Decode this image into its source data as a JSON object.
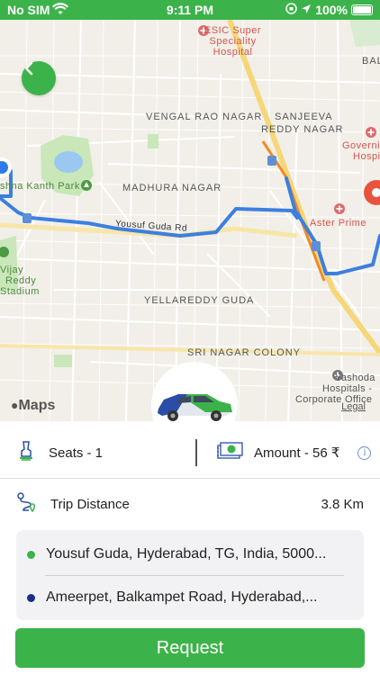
{
  "status_bar": {
    "carrier": "No SIM",
    "time": "9:11 PM",
    "battery": "100%"
  },
  "map": {
    "labels": {
      "hospital": "ESIC Super\nSpeciality\nHospital",
      "bal": "BAL",
      "vengal": "VENGAL RAO NAGAR",
      "sanjeeva_1": "SANJEEVA",
      "sanjeeva_2": "REDDY NAGAR",
      "govt_1": "Governi",
      "govt_2": "Hospi",
      "park": "shna Kanth Park",
      "madhura": "MADHURA NAGAR",
      "aster": "Aster Prime",
      "road": "Yousuf Guda Rd",
      "vijay_1": "Vijay",
      "vijay_2": "Reddy",
      "vijay_3": "Stadium",
      "yellareddy": "YELLAREDDY GUDA",
      "srinagar": "SRI NAGAR COLONY",
      "yashoda_1": "Yashoda",
      "yashoda_2": "Hospitals -",
      "yashoda_3": "Corporate Office"
    },
    "attribution": "Maps",
    "legal": "Legal"
  },
  "trip": {
    "seats_label": "Seats - 1",
    "amount_label": "Amount - 56 ₹",
    "distance_label": "Trip Distance",
    "distance_value": "3.8 Km"
  },
  "addresses": {
    "pickup": "Yousuf Guda, Hyderabad, TG, India, 5000...",
    "drop": "Ameerpet, Balkampet Road, Hyderabad,..."
  },
  "actions": {
    "request_label": "Request"
  },
  "colors": {
    "brand_green": "#3cb34a",
    "route_blue": "#3d7fe0",
    "drop_dot": "#1b2f8a"
  }
}
